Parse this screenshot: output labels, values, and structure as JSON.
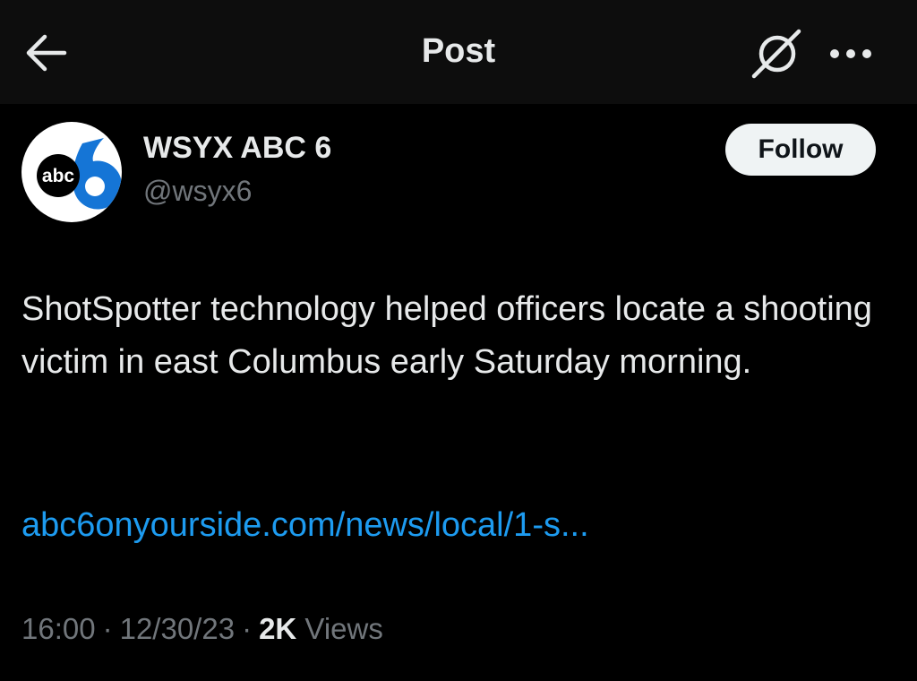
{
  "header": {
    "title": "Post",
    "back_icon": "arrow-left-icon",
    "grok_icon": "grok-icon",
    "more_icon": "more-horizontal-icon"
  },
  "author": {
    "display_name": "WSYX ABC 6",
    "handle": "@wsyx6",
    "avatar_logo_text": "abc",
    "avatar_logo_number": "6",
    "follow_label": "Follow"
  },
  "post": {
    "text": "ShotSpotter technology helped officers locate a shooting victim in east Columbus early Saturday morning.",
    "link": "abc6onyourside.com/news/local/1-s..."
  },
  "meta": {
    "time": "16:00",
    "separator": "·",
    "date": "12/30/23",
    "views_count": "2K",
    "views_label": "Views"
  },
  "colors": {
    "background": "#000000",
    "header_background": "#0d0d0d",
    "text_primary": "#e7e9ea",
    "text_secondary": "#71767b",
    "link": "#1d9bf0",
    "follow_button": "#eff3f4",
    "logo_blue": "#1575d6"
  }
}
